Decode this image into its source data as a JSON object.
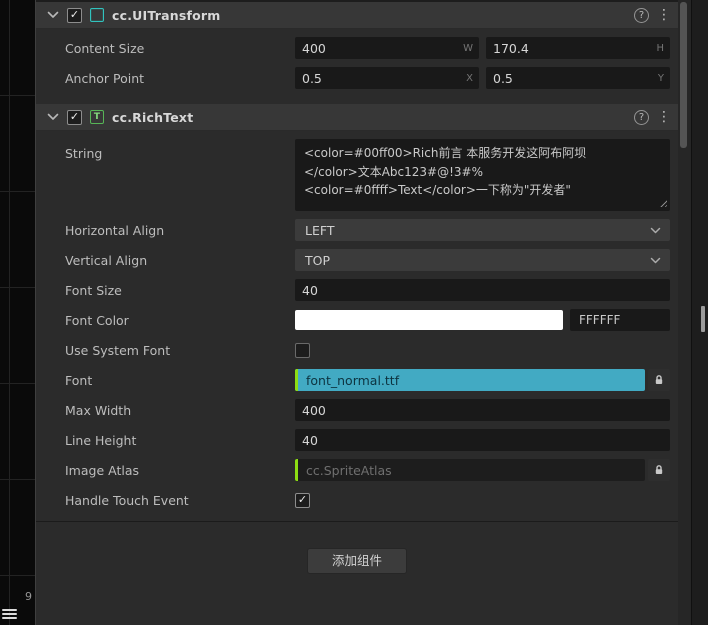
{
  "icons": {
    "check_glyph": "✓",
    "help_glyph": "?",
    "menu_glyph": "⋮",
    "richtext_glyph": "T"
  },
  "colors": {
    "accent_green": "#8ddd13",
    "font_field_teal": "#42aac3",
    "uitransform_icon_teal": "#31c3be",
    "richtext_icon_green": "#57b557"
  },
  "inspector": {
    "uitransform": {
      "title": "cc.UITransform",
      "enabled": true,
      "content_size": {
        "label": "Content Size",
        "w": "400",
        "w_suffix": "W",
        "h": "170.4",
        "h_suffix": "H"
      },
      "anchor_point": {
        "label": "Anchor Point",
        "x": "0.5",
        "x_suffix": "X",
        "y": "0.5",
        "y_suffix": "Y"
      }
    },
    "richtext": {
      "title": "cc.RichText",
      "enabled": true,
      "string": {
        "label": "String",
        "value": "<color=#00ff00>Rich前言 本服务开发这阿布阿坝\n</color>文本Abc123#@!3#%\n<color=#0ffff>Text</color>一下称为\"开发者\""
      },
      "horizontal_align": {
        "label": "Horizontal Align",
        "value": "LEFT"
      },
      "vertical_align": {
        "label": "Vertical Align",
        "value": "TOP"
      },
      "font_size": {
        "label": "Font Size",
        "value": "40"
      },
      "font_color": {
        "label": "Font Color",
        "hex": "FFFFFF",
        "swatch_color": "#ffffff"
      },
      "use_system_font": {
        "label": "Use System Font",
        "checked": false
      },
      "font": {
        "label": "Font",
        "value": "font_normal.ttf"
      },
      "max_width": {
        "label": "Max Width",
        "value": "400"
      },
      "line_height": {
        "label": "Line Height",
        "value": "40"
      },
      "image_atlas": {
        "label": "Image Atlas",
        "placeholder": "cc.SpriteAtlas"
      },
      "handle_touch_event": {
        "label": "Handle Touch Event",
        "checked": true
      }
    },
    "add_component_label": "添加组件"
  },
  "scene_gutter": {
    "ruler_number": "9"
  }
}
